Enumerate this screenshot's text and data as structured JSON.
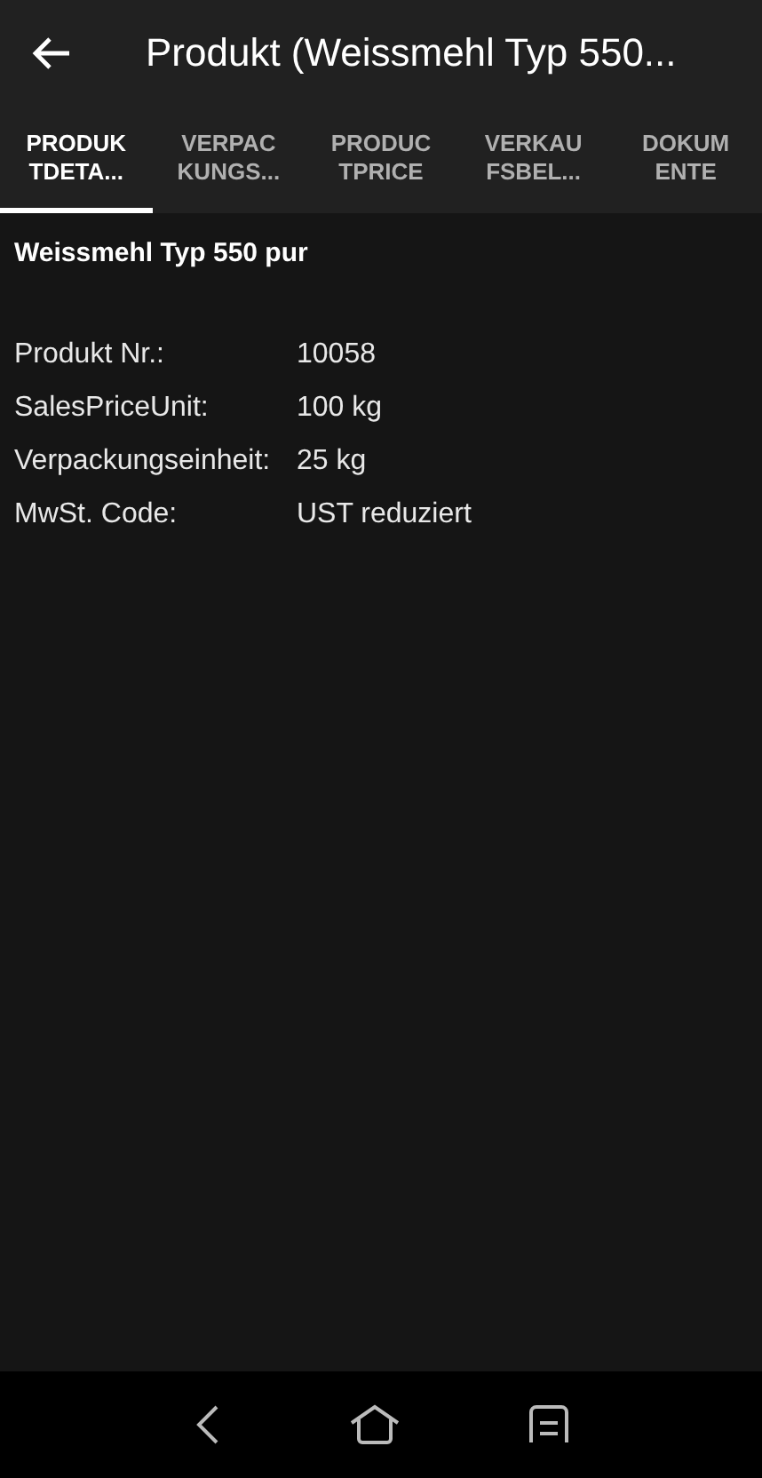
{
  "app_bar": {
    "title": "Produkt (Weissmehl Typ 550..."
  },
  "tabs": [
    {
      "lines": [
        "PRODUK",
        "TDETA..."
      ],
      "selected": true
    },
    {
      "lines": [
        "VERPAC",
        "KUNGS..."
      ],
      "selected": false
    },
    {
      "lines": [
        "PRODUC",
        "TPRICE"
      ],
      "selected": false
    },
    {
      "lines": [
        "VERKAU",
        "FSBEL..."
      ],
      "selected": false
    },
    {
      "lines": [
        "DOKUM",
        "ENTE"
      ],
      "selected": false
    }
  ],
  "product_name": "Weissmehl Typ 550 pur",
  "fields": [
    {
      "label": "Produkt Nr.:",
      "value": "10058"
    },
    {
      "label": "SalesPriceUnit:",
      "value": "100 kg"
    },
    {
      "label": "Verpackungseinheit:",
      "value": "25 kg"
    },
    {
      "label": "MwSt. Code:",
      "value": "UST reduziert"
    }
  ]
}
